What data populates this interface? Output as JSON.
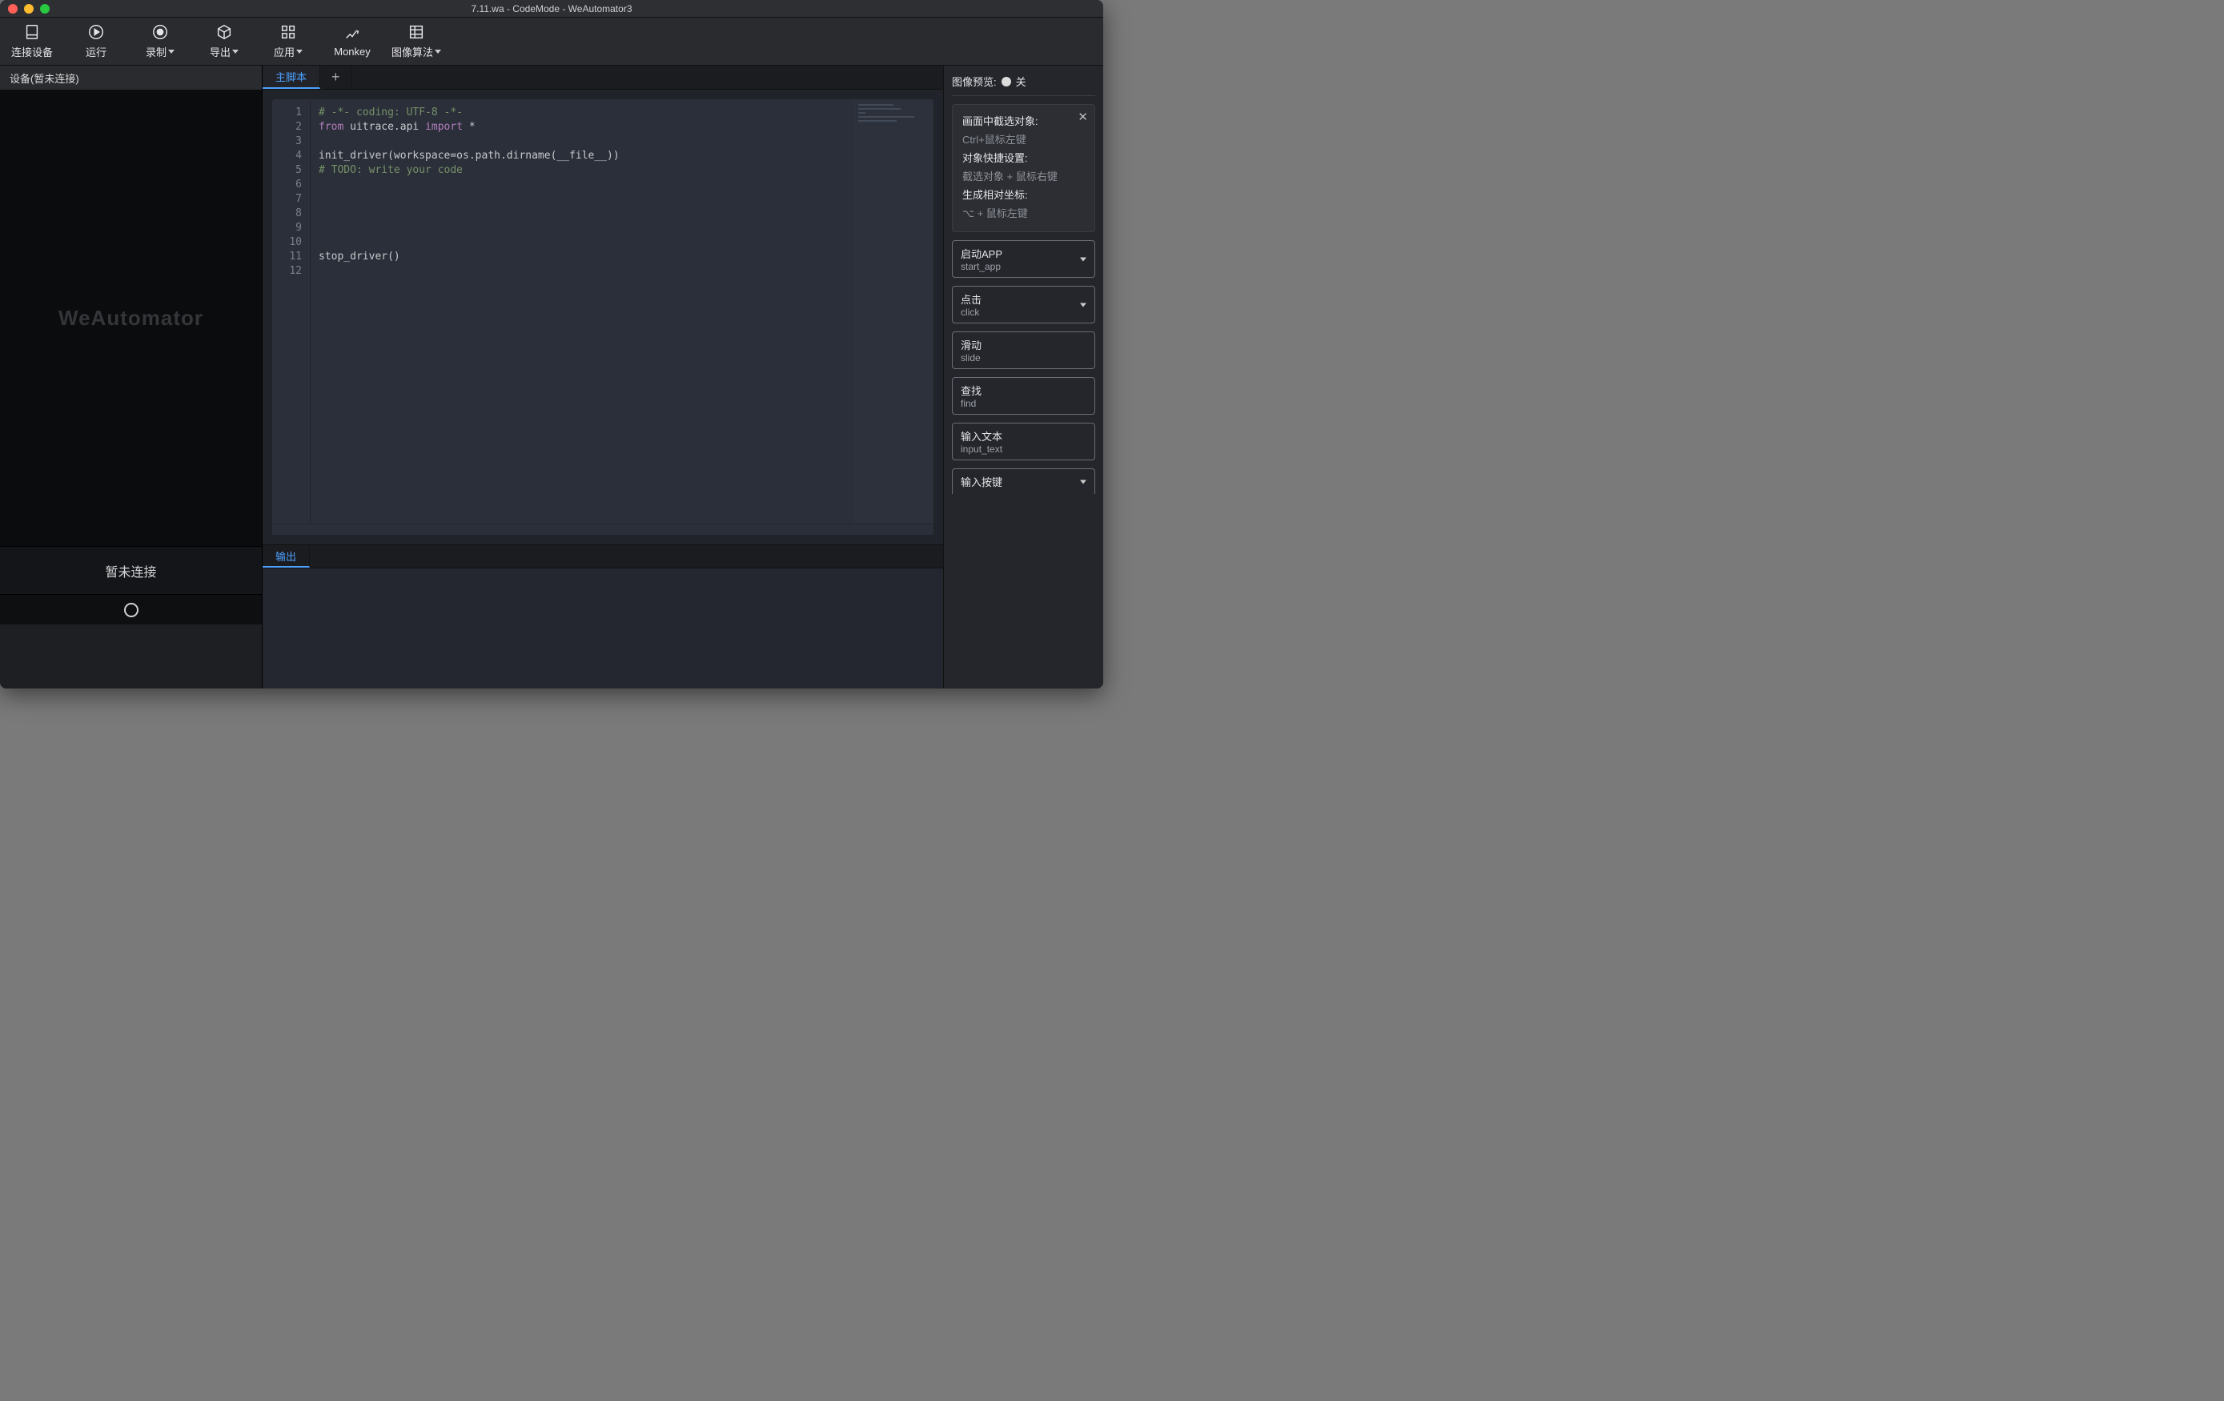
{
  "window": {
    "title": "7.11.wa - CodeMode - WeAutomator3"
  },
  "toolbar": {
    "connect": "连接设备",
    "run": "运行",
    "record": "录制",
    "export": "导出",
    "apply": "应用",
    "monkey": "Monkey",
    "image_algo": "图像算法"
  },
  "device": {
    "header": "设备(暂未连接)",
    "watermark": "WeAutomator",
    "status": "暂未连接"
  },
  "tabs": {
    "main": "主脚本",
    "add": "+"
  },
  "editor": {
    "line_count": 12,
    "code_lines": [
      {
        "n": 1,
        "tokens": [
          {
            "t": "# -*- coding: UTF-8 -*-",
            "c": "comment"
          }
        ]
      },
      {
        "n": 2,
        "tokens": [
          {
            "t": "from",
            "c": "keyword"
          },
          {
            "t": " uitrace.api ",
            "c": "plain"
          },
          {
            "t": "import",
            "c": "keyword"
          },
          {
            "t": " *",
            "c": "plain"
          }
        ]
      },
      {
        "n": 3,
        "tokens": []
      },
      {
        "n": 4,
        "tokens": [
          {
            "t": "init_driver(workspace=os.path.dirname(__file__))",
            "c": "plain"
          }
        ]
      },
      {
        "n": 5,
        "tokens": [
          {
            "t": "# TODO: write your code",
            "c": "comment"
          }
        ]
      },
      {
        "n": 6,
        "tokens": []
      },
      {
        "n": 7,
        "tokens": []
      },
      {
        "n": 8,
        "tokens": []
      },
      {
        "n": 9,
        "tokens": []
      },
      {
        "n": 10,
        "tokens": []
      },
      {
        "n": 11,
        "tokens": [
          {
            "t": "stop_driver()",
            "c": "plain"
          }
        ]
      },
      {
        "n": 12,
        "tokens": []
      }
    ]
  },
  "output": {
    "label": "输出"
  },
  "right": {
    "preview_label": "图像预览:",
    "preview_state": "关",
    "help": {
      "select_label": "画面中截选对象:",
      "select_hint": "Ctrl+鼠标左键",
      "quick_label": "对象快捷设置:",
      "quick_hint": "截选对象 + 鼠标右键",
      "coord_label": "生成相对坐标:",
      "coord_hint": "⌥ + 鼠标左键"
    },
    "actions": [
      {
        "cn": "启动APP",
        "en": "start_app",
        "dropdown": true
      },
      {
        "cn": "点击",
        "en": "click",
        "dropdown": true
      },
      {
        "cn": "滑动",
        "en": "slide",
        "dropdown": false
      },
      {
        "cn": "查找",
        "en": "find",
        "dropdown": false
      },
      {
        "cn": "输入文本",
        "en": "input_text",
        "dropdown": false
      },
      {
        "cn": "输入按键",
        "en": "",
        "dropdown": true,
        "partial": true
      }
    ]
  }
}
